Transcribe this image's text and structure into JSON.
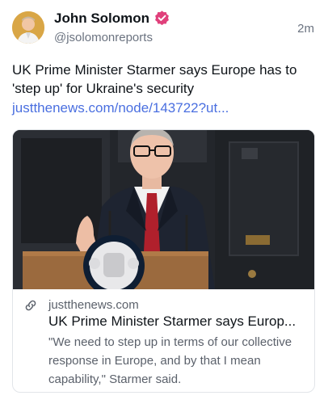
{
  "author": {
    "name": "John Solomon",
    "handle": "@jsolomonreports",
    "verified_icon": "verified-badge-icon",
    "verified_color": "#e0407b"
  },
  "post": {
    "time": "2m",
    "text": "UK Prime Minister Starmer says Europe has to 'step up' for Ukraine's security",
    "link": "justthenews.com/node/143722?ut...",
    "link_color": "#4a6fe0"
  },
  "card": {
    "link_icon": "link-icon",
    "domain": "justthenews.com",
    "title": "UK Prime Minister Starmer says Europ...",
    "description": "\"We need to step up in terms of our collective response in Europe, and by that I mean capability,\" Starmer said."
  }
}
